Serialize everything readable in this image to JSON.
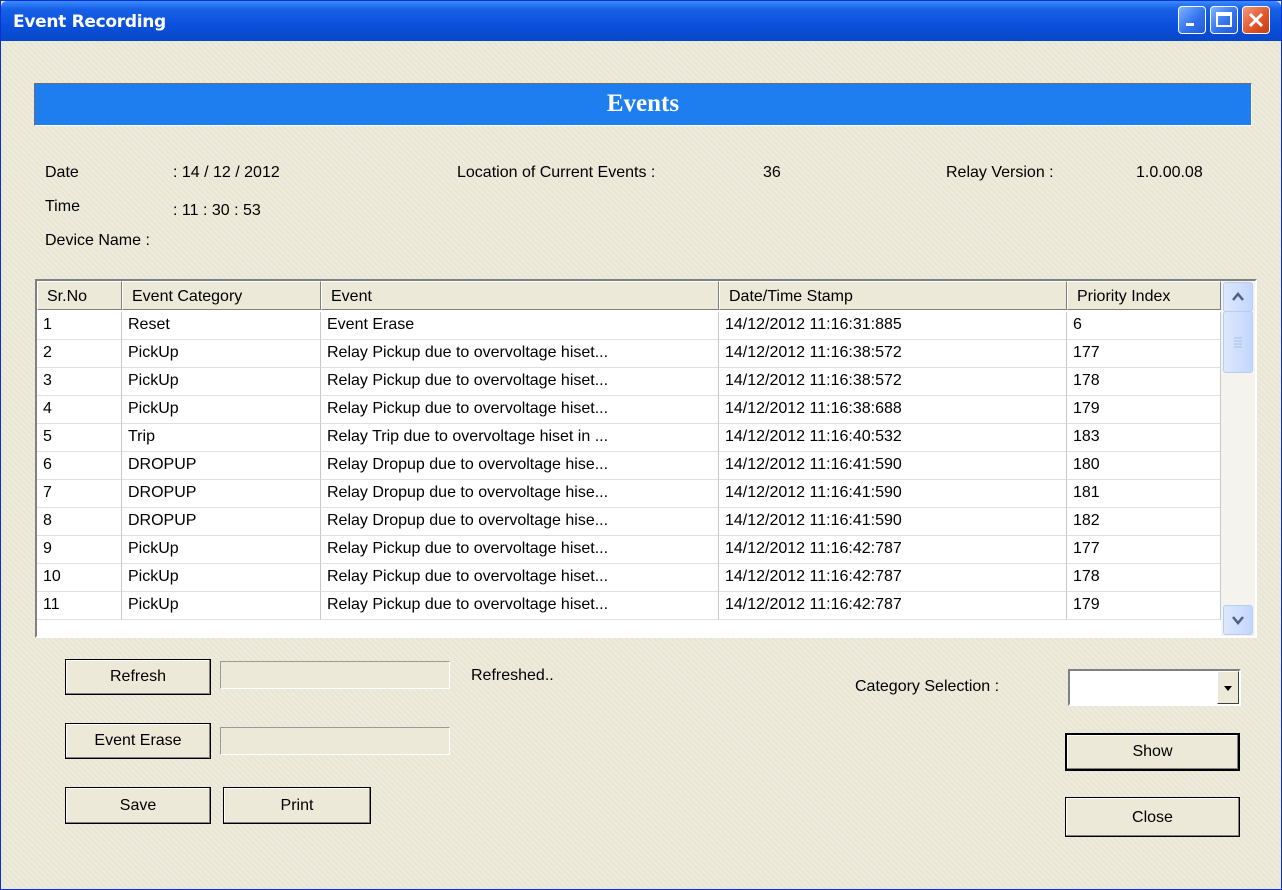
{
  "window": {
    "title": "Event Recording"
  },
  "banner": {
    "title": "Events"
  },
  "info": {
    "date_label": "Date",
    "date_value": ": 14  / 12  / 2012",
    "time_label": "Time",
    "time_value": ": 11  :  30  :  53",
    "device_label": "Device Name :",
    "location_label": "Location of Current Events  :",
    "location_value": "36",
    "relay_label": "Relay  Version :",
    "relay_value": "1.0.00.08"
  },
  "table": {
    "columns": [
      "Sr.No",
      "Event Category",
      "Event",
      "Date/Time Stamp",
      "Priority Index"
    ],
    "rows": [
      [
        "1",
        "Reset",
        "Event Erase",
        "14/12/2012  11:16:31:885",
        "6"
      ],
      [
        "2",
        "PickUp",
        "Relay Pickup due to overvoltage hiset...",
        "14/12/2012  11:16:38:572",
        "177"
      ],
      [
        "3",
        "PickUp",
        "Relay Pickup due to overvoltage hiset...",
        "14/12/2012  11:16:38:572",
        "178"
      ],
      [
        "4",
        "PickUp",
        "Relay Pickup due to overvoltage hiset...",
        "14/12/2012  11:16:38:688",
        "179"
      ],
      [
        "5",
        "Trip",
        "Relay Trip due to overvoltage hiset in ...",
        "14/12/2012  11:16:40:532",
        "183"
      ],
      [
        "6",
        "DROPUP",
        "Relay Dropup due to overvoltage hise...",
        "14/12/2012  11:16:41:590",
        "180"
      ],
      [
        "7",
        "DROPUP",
        "Relay Dropup due to overvoltage hise...",
        "14/12/2012  11:16:41:590",
        "181"
      ],
      [
        "8",
        "DROPUP",
        "Relay Dropup due to overvoltage hise...",
        "14/12/2012  11:16:41:590",
        "182"
      ],
      [
        "9",
        "PickUp",
        "Relay Pickup due to overvoltage hiset...",
        "14/12/2012  11:16:42:787",
        "177"
      ],
      [
        "10",
        "PickUp",
        "Relay Pickup due to overvoltage hiset...",
        "14/12/2012  11:16:42:787",
        "178"
      ],
      [
        "11",
        "PickUp",
        "Relay Pickup due to overvoltage hiset...",
        "14/12/2012  11:16:42:787",
        "179"
      ]
    ]
  },
  "controls": {
    "refresh_label": "Refresh",
    "refresh_status": "Refreshed..",
    "erase_label": "Event Erase",
    "save_label": "Save",
    "print_label": "Print",
    "category_label": "Category Selection :",
    "category_value": "",
    "show_label": "Show",
    "close_label": "Close"
  },
  "colors": {
    "banner": "#1e7ef0",
    "titlebar": "#0a50dc"
  },
  "icons": [
    "minimize-icon",
    "maximize-icon",
    "close-icon",
    "scroll-up-icon",
    "scroll-down-icon",
    "dropdown-arrow-icon"
  ]
}
